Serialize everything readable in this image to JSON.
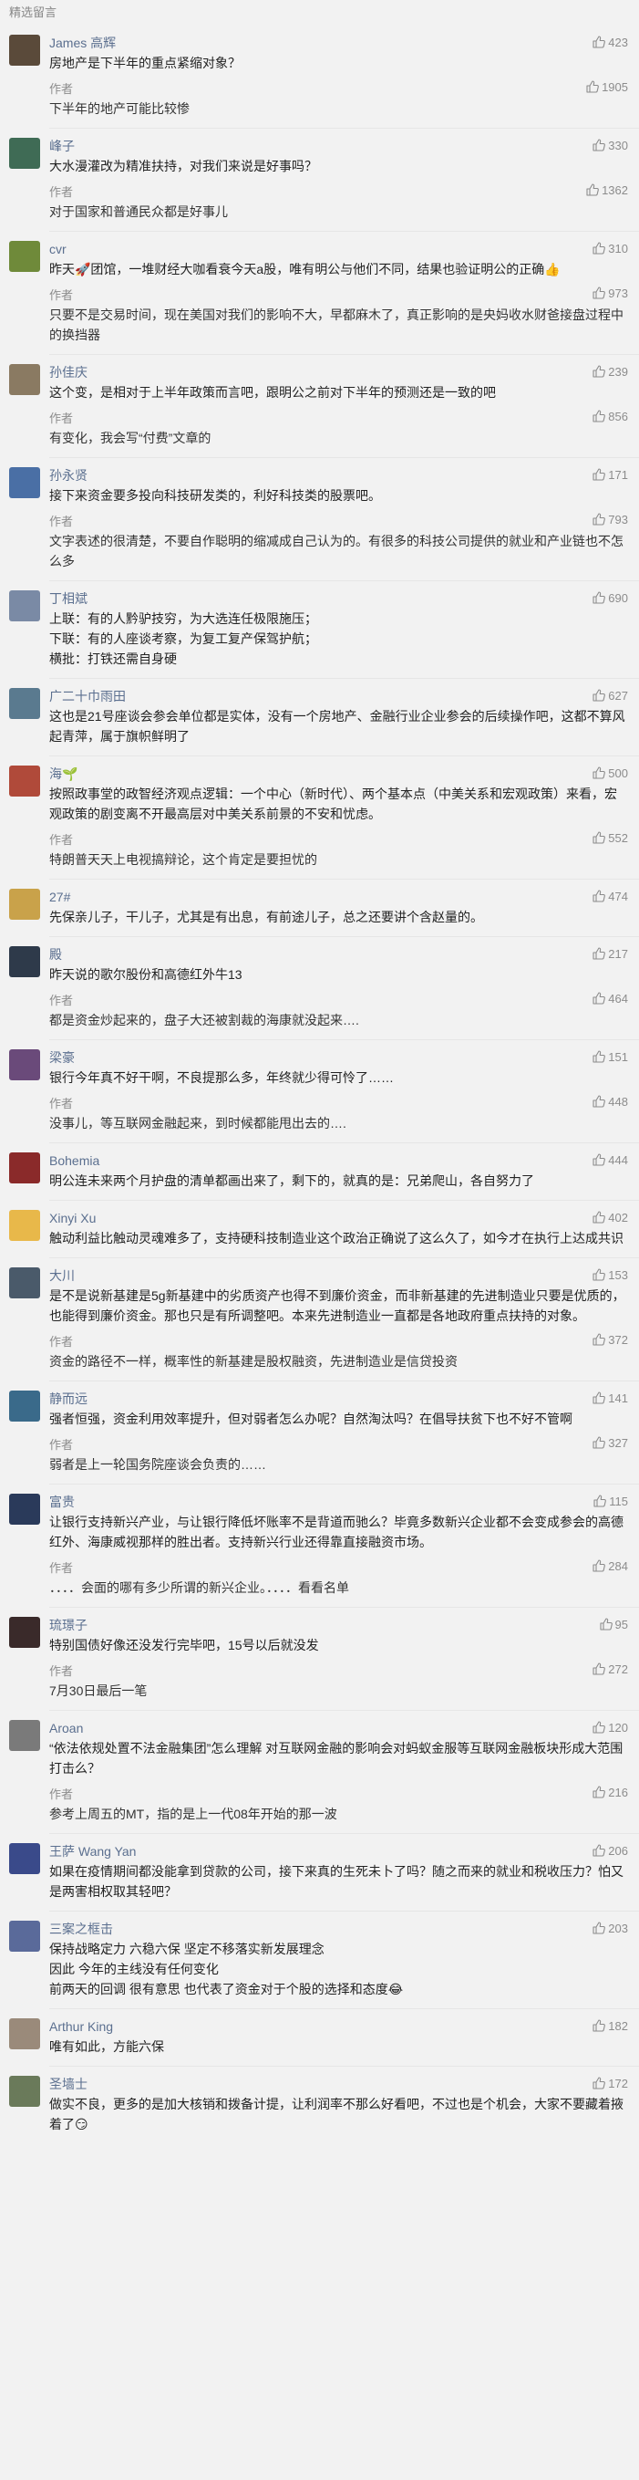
{
  "header": {
    "title": "精选留言"
  },
  "comments": [
    {
      "user": "James 高辉",
      "likes": "423",
      "text": "房地产是下半年的重点紧缩对象？",
      "avatar_color": "#5a4a3a",
      "reply": {
        "label": "作者",
        "likes": "1905",
        "text": "下半年的地产可能比较惨"
      }
    },
    {
      "user": "峰子",
      "likes": "330",
      "text": "大水漫灌改为精准扶持，对我们来说是好事吗？",
      "avatar_color": "#3f6b55",
      "reply": {
        "label": "作者",
        "likes": "1362",
        "text": "对于国家和普通民众都是好事儿"
      }
    },
    {
      "user": "cvr",
      "likes": "310",
      "text": "昨天🚀团馆，一堆财经大咖看衰今天a股，唯有明公与他们不同，结果也验证明公的正确👍",
      "avatar_color": "#6f8a3a",
      "reply": {
        "label": "作者",
        "likes": "973",
        "text": "只要不是交易时间，现在美国对我们的影响不大，早都麻木了，真正影响的是央妈收水财爸接盘过程中的换挡器"
      }
    },
    {
      "user": "孙佳庆",
      "likes": "239",
      "text": "这个变，是相对于上半年政策而言吧，跟明公之前对下半年的预测还是一致的吧",
      "avatar_color": "#8a7a62",
      "reply": {
        "label": "作者",
        "likes": "856",
        "text": "有变化，我会写“付费”文章的"
      }
    },
    {
      "user": "孙永贤",
      "likes": "171",
      "text": "接下来资金要多投向科技研发类的，利好科技类的股票吧。",
      "avatar_color": "#4a6fa5",
      "reply": {
        "label": "作者",
        "likes": "793",
        "text": "文字表述的很清楚，不要自作聪明的缩减成自己认为的。有很多的科技公司提供的就业和产业链也不怎么多"
      }
    },
    {
      "user": "丁相斌",
      "likes": "690",
      "text": "上联：有的人黔驴技穷，为大选连任极限施压；\n下联：有的人座谈考察，为复工复产保驾护航；\n横批：打铁还需自身硬",
      "avatar_color": "#7a8aa5",
      "reply": null
    },
    {
      "user": "广二十巾雨田",
      "likes": "627",
      "text": "这也是21号座谈会参会单位都是实体，没有一个房地产、金融行业企业参会的后续操作吧，这都不算风起青萍，属于旗帜鲜明了",
      "avatar_color": "#5a7a8f",
      "reply": null
    },
    {
      "user": "海🌱",
      "likes": "500",
      "text": "按照政事堂的政智经济观点逻辑：一个中心（新时代）、两个基本点（中美关系和宏观政策）来看，宏观政策的剧变离不开最高层对中美关系前景的不安和忧虑。",
      "avatar_color": "#b04a3a",
      "reply": {
        "label": "作者",
        "likes": "552",
        "text": "特朗普天天上电视搞辩论，这个肯定是要担忧的"
      }
    },
    {
      "user": "27#",
      "likes": "474",
      "text": "先保亲儿子，干儿子，尤其是有出息，有前途儿子，总之还要讲个含赵量的。",
      "avatar_color": "#c9a24a",
      "reply": null
    },
    {
      "user": "殿",
      "likes": "217",
      "text": "昨天说的歌尔股份和高德红外牛13",
      "avatar_color": "#2e3a4a",
      "reply": {
        "label": "作者",
        "likes": "464",
        "text": "都是资金炒起来的，盘子大还被割裁的海康就没起来…."
      }
    },
    {
      "user": "梁豪",
      "likes": "151",
      "text": "银行今年真不好干啊，不良提那么多，年终就少得可怜了……",
      "avatar_color": "#6a4a7a",
      "reply": {
        "label": "作者",
        "likes": "448",
        "text": "没事儿，等互联网金融起来，到时候都能甩出去的…."
      }
    },
    {
      "user": "Bohemia",
      "likes": "444",
      "text": "明公连未来两个月护盘的清单都画出来了，剩下的，就真的是：兄弟爬山，各自努力了",
      "avatar_color": "#8a2a2a",
      "reply": null
    },
    {
      "user": "Xinyi Xu",
      "likes": "402",
      "text": "触动利益比触动灵魂难多了，支持硬科技制造业这个政治正确说了这么久了，如今才在执行上达成共识",
      "avatar_color": "#e8b84a",
      "reply": null
    },
    {
      "user": "大川",
      "likes": "153",
      "text": "是不是说新基建是5g新基建中的劣质资产也得不到廉价资金，而非新基建的先进制造业只要是优质的，也能得到廉价资金。那也只是有所调整吧。本来先进制造业一直都是各地政府重点扶持的对象。",
      "avatar_color": "#4a5a6a",
      "reply": {
        "label": "作者",
        "likes": "372",
        "text": "资金的路径不一样，概率性的新基建是股权融资，先进制造业是信贷投资"
      }
    },
    {
      "user": "静而远",
      "likes": "141",
      "text": "强者恒强，资金利用效率提升，但对弱者怎么办呢？自然淘汰吗？在倡导扶贫下也不好不管啊",
      "avatar_color": "#3a6a8a",
      "reply": {
        "label": "作者",
        "likes": "327",
        "text": "弱者是上一轮国务院座谈会负责的……"
      }
    },
    {
      "user": "富贵",
      "likes": "115",
      "text": "让银行支持新兴产业，与让银行降低坏账率不是背道而驰么？毕竟多数新兴企业都不会变成参会的高德红外、海康威视那样的胜出者。支持新兴行业还得靠直接融资市场。",
      "avatar_color": "#2a3a5a",
      "reply": {
        "label": "作者",
        "likes": "284",
        "text": "．．．．会面的哪有多少所谓的新兴企业。．．．．看看名单"
      }
    },
    {
      "user": "琉璟子",
      "likes": "95",
      "text": "特别国债好像还没发行完毕吧，15号以后就没发",
      "avatar_color": "#3a2a2a",
      "reply": {
        "label": "作者",
        "likes": "272",
        "text": "7月30日最后一笔"
      }
    },
    {
      "user": "Aroan",
      "likes": "120",
      "text": "“依法依规处置不法金融集团”怎么理解 对互联网金融的影响会对蚂蚁金服等互联网金融板块形成大范围打击么？",
      "avatar_color": "#7a7a7a",
      "reply": {
        "label": "作者",
        "likes": "216",
        "text": "参考上周五的MT，指的是上一代08年开始的那一波"
      }
    },
    {
      "user": "王萨 Wang Yan",
      "likes": "206",
      "text": "如果在疫情期间都没能拿到贷款的公司，接下来真的生死未卜了吗？随之而来的就业和税收压力？怕又是两害相权取其轻吧？",
      "avatar_color": "#3a4a8a",
      "reply": null
    },
    {
      "user": "三案之框击",
      "likes": "203",
      "text": "保持战略定力 六稳六保 坚定不移落实新发展理念\n因此 今年的主线没有任何变化\n前两天的回调 很有意思 也代表了资金对于个股的选择和态度😂",
      "avatar_color": "#5a6a9a",
      "reply": null
    },
    {
      "user": "Arthur King",
      "likes": "182",
      "text": "唯有如此，方能六保",
      "avatar_color": "#9a8a7a",
      "reply": null
    },
    {
      "user": "圣墙士",
      "likes": "172",
      "text": "做实不良，更多的是加大核销和拨备计提，让利润率不那么好看吧，不过也是个机会，大家不要藏着掖着了😏",
      "avatar_color": "#6a7a5a",
      "reply": null
    }
  ]
}
